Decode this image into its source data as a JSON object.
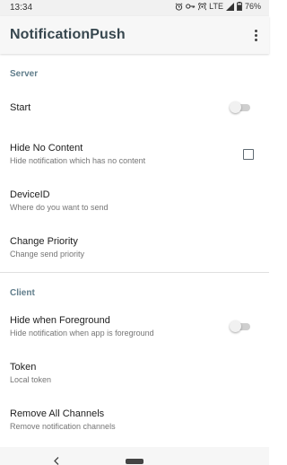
{
  "status_bar": {
    "time": "13:34",
    "network": "LTE",
    "battery": "76%",
    "icons": [
      "alarm-icon",
      "key-icon",
      "hotspot-icon",
      "signal-icon",
      "battery-icon"
    ]
  },
  "app_bar": {
    "title": "NotificationPush",
    "menu_icon": "overflow-menu-icon"
  },
  "sections": {
    "server": {
      "header": "Server",
      "start": {
        "title": "Start",
        "checked": false
      },
      "hide_no_content": {
        "title": "Hide No Content",
        "summary": "Hide notification which has no content",
        "checked": false
      },
      "device_id": {
        "title": "DeviceID",
        "summary": "Where do you want to send"
      },
      "change_priority": {
        "title": "Change Priority",
        "summary": "Change send priority"
      }
    },
    "client": {
      "header": "Client",
      "hide_when_foreground": {
        "title": "Hide when Foreground",
        "summary": "Hide notification when app is foreground",
        "checked": false
      },
      "token": {
        "title": "Token",
        "summary": "Local token"
      },
      "remove_all_channels": {
        "title": "Remove All Channels",
        "summary": "Remove notification channels"
      }
    }
  },
  "colors": {
    "category_text": "#607d8b",
    "title_text": "#37474f",
    "switch_off_track": "#cfcfcf",
    "switch_off_thumb": "#f1f1f1"
  }
}
